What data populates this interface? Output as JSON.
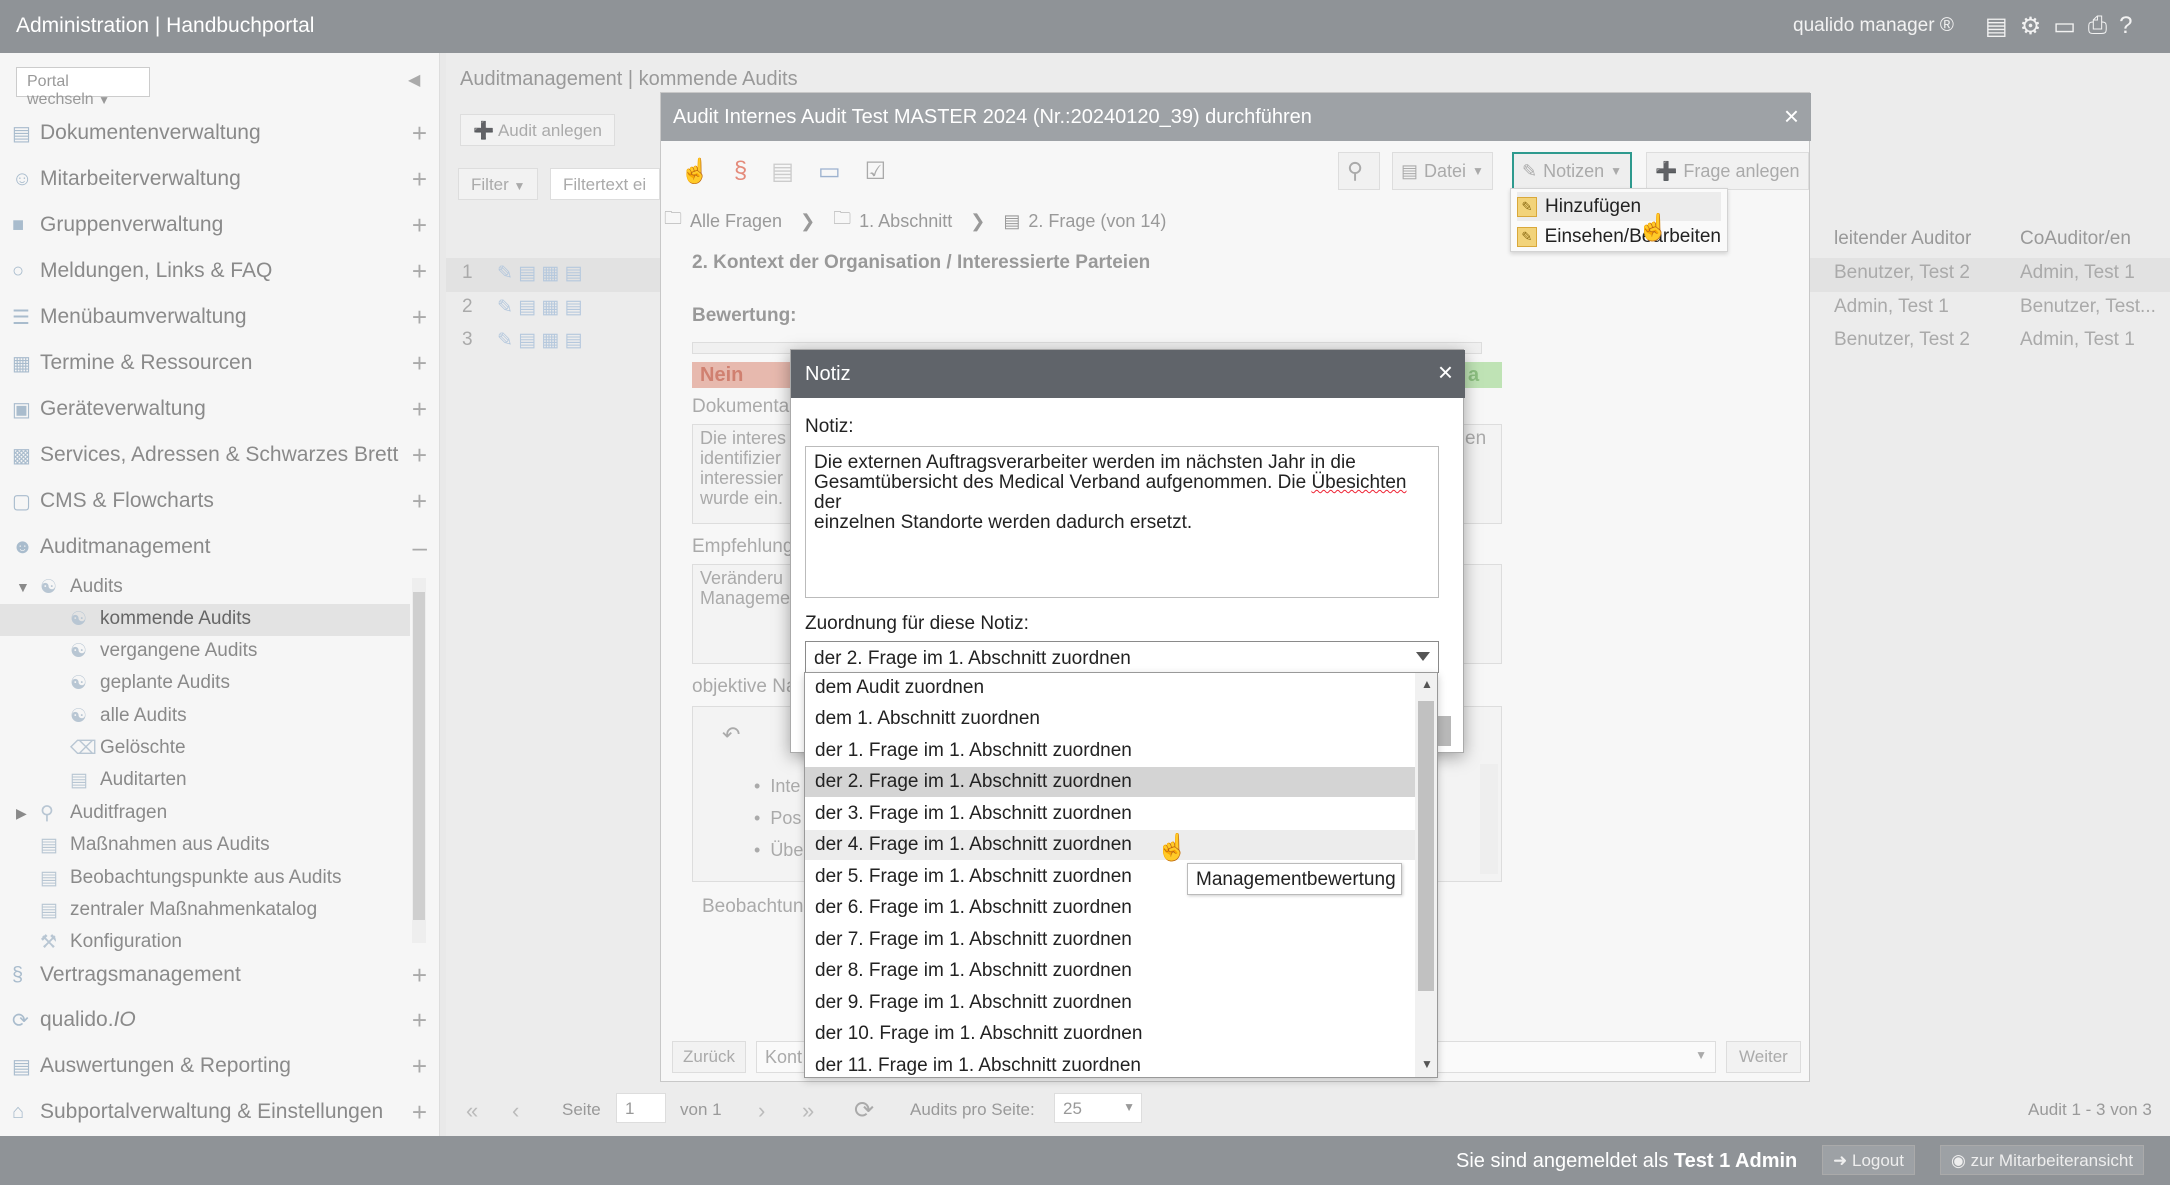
{
  "topbar": {
    "title": "Administration | Handbuchportal",
    "brand": "qualido manager ®",
    "icons": [
      "book-icon",
      "users-icon",
      "pdf-icon",
      "print-icon",
      "help-icon"
    ],
    "help": "?"
  },
  "sidebar": {
    "portal_select": "Portal wechseln",
    "items": [
      {
        "label": "Dokumentenverwaltung",
        "icon": "documents-icon"
      },
      {
        "label": "Mitarbeiterverwaltung",
        "icon": "users-icon"
      },
      {
        "label": "Gruppenverwaltung",
        "icon": "group-icon"
      },
      {
        "label": "Meldungen, Links & FAQ",
        "icon": "chat-icon"
      },
      {
        "label": "Menübaumverwaltung",
        "icon": "list-icon"
      },
      {
        "label": "Termine & Ressourcen",
        "icon": "calendar-icon"
      },
      {
        "label": "Geräteverwaltung",
        "icon": "device-icon"
      },
      {
        "label": "Services, Adressen & Schwarzes Brett",
        "icon": "board-icon"
      },
      {
        "label": "CMS & Flowcharts",
        "icon": "cms-icon"
      },
      {
        "label": "Auditmanagement",
        "icon": "audit-icon"
      }
    ],
    "audit_tree": {
      "audits": "Audits",
      "children": [
        "kommende Audits",
        "vergangene Audits",
        "geplante Audits",
        "alle Audits",
        "Gelöschte",
        "Auditarten"
      ],
      "auditfragen": "Auditfragen",
      "others": [
        "Maßnahmen aus Audits",
        "Beobachtungspunkte aus Audits",
        "zentraler Maßnahmenkatalog",
        "Konfiguration"
      ]
    },
    "bottom_items": [
      {
        "label": "Vertragsmanagement",
        "icon": "paragraph-icon"
      },
      {
        "label": "qualido.",
        "label_suffix": "IO",
        "icon": "io-icon"
      },
      {
        "label": "Auswertungen & Reporting",
        "icon": "chart-icon"
      },
      {
        "label": "Subportalverwaltung & Einstellungen",
        "icon": "home-icon"
      }
    ]
  },
  "main": {
    "title": "Auditmanagement | kommende Audits",
    "audit_anlegen": "Audit anlegen",
    "filter": "Filter",
    "filter_placeholder": "Filtertext ei",
    "table": {
      "headers": [
        "leitender Auditor",
        "CoAuditor/en"
      ],
      "row_numbers": [
        "1",
        "2",
        "3"
      ],
      "rows": [
        [
          "Benutzer, Test 2",
          "Admin, Test 1"
        ],
        [
          "Admin, Test 1",
          "Benutzer, Test..."
        ],
        [
          "Benutzer, Test 2",
          "Admin, Test 1"
        ]
      ]
    },
    "pager": {
      "page_label": "Seite",
      "page": "1",
      "of": "von 1",
      "per_page_label": "Audits pro Seite:",
      "per_page": "25",
      "summary": "Audit 1 - 3 von 3"
    }
  },
  "statusbar": {
    "logged_in_prefix": "Sie sind angemeldet als",
    "user": "Test 1 Admin",
    "logout": "Logout",
    "employee_view": "zur Mitarbeiteransicht"
  },
  "audit_dialog": {
    "title": "Audit Internes Audit Test MASTER 2024 (Nr.:20240120_39) durchführen",
    "datei": "Datei",
    "notizen": "Notizen",
    "frage_anlegen": "Frage anlegen",
    "breadcrumb": [
      "Alle Fragen",
      "1. Abschnitt",
      "2. Frage (von 14)"
    ],
    "question_title": "2. Kontext der Organisation / Interessierte Parteien",
    "bewertung": "Bewertung:",
    "nein": "Nein",
    "ja_fragment": "a",
    "dokumenta": "Dokumenta",
    "text_fragment": [
      "Die interes",
      "identifizier",
      "interessier",
      "wurde ein."
    ],
    "text_fragment_right": "en",
    "empfehlung": "Empfehlung",
    "empf_fragment": [
      "Veränderu",
      "Manageme"
    ],
    "objektive": "objektive Na",
    "bullets": [
      "Inte",
      "Pos",
      "Übe"
    ],
    "beobachtung": "Beobachtung",
    "zurueck": "Zurück",
    "kont": "Kont",
    "weiter": "Weiter"
  },
  "notizen_menu": {
    "items": [
      "Hinzufügen",
      "Einsehen/Bearbeiten"
    ]
  },
  "notiz_dialog": {
    "title": "Notiz",
    "close": "×",
    "label": "Notiz:",
    "text_before": "Die externen Auftragsverarbeiter werden im nächsten Jahr in die\nGesamtübersicht des Medical Verband aufgenommen. Die ",
    "text_misspelled": "Übesichten",
    "text_after": " der\neinzelnen Standorte werden dadurch ersetzt.",
    "zuordnung_label": "Zuordnung für diese Notiz:",
    "selected": "der 2. Frage im 1. Abschnitt zuordnen",
    "options": [
      "dem Audit zuordnen",
      "dem 1. Abschnitt zuordnen",
      "der 1. Frage im 1. Abschnitt zuordnen",
      "der 2. Frage im 1. Abschnitt zuordnen",
      "der 3. Frage im 1. Abschnitt zuordnen",
      "der 4. Frage im 1. Abschnitt zuordnen",
      "der 5. Frage im 1. Abschnitt zuordnen",
      "der 6. Frage im 1. Abschnitt zuordnen",
      "der 7. Frage im 1. Abschnitt zuordnen",
      "der 8. Frage im 1. Abschnitt zuordnen",
      "der 9. Frage im 1. Abschnitt zuordnen",
      "der 10. Frage im 1. Abschnitt zuordnen",
      "der 11. Frage im 1. Abschnitt zuordnen"
    ],
    "tooltip": "Managementbewertung"
  },
  "colors": {
    "topbar": "#8f9397",
    "notiz_header": "#60646a",
    "nein": "#e7b9ae",
    "ja": "#bfe3b5",
    "notizen_border": "#2e9a8e"
  }
}
